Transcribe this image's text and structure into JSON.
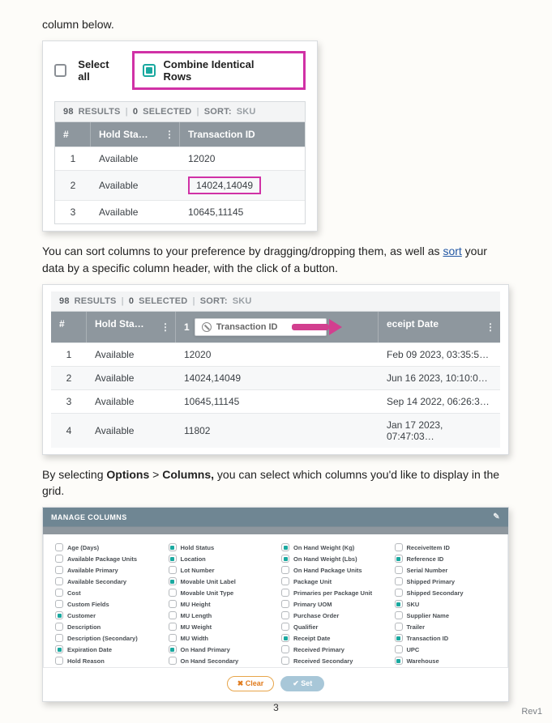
{
  "intro_text": "column below.",
  "select_all_label": "Select all",
  "combine_label": "Combine Identical Rows",
  "results_bar": {
    "count": "98",
    "results_word": "RESULTS",
    "selected_count": "0",
    "selected_word": "SELECTED",
    "sort_label": "SORT:",
    "sort_value": "SKU"
  },
  "headers1": {
    "idx": "#",
    "hold": "Hold Sta…",
    "txn": "Transaction ID"
  },
  "rows1": [
    {
      "n": "1",
      "hold": "Available",
      "txn": "12020"
    },
    {
      "n": "2",
      "hold": "Available",
      "txn": "14024,14049"
    },
    {
      "n": "3",
      "hold": "Available",
      "txn": "10645,11145"
    }
  ],
  "para2a": "You can sort columns to your preference by dragging/dropping them, as well as ",
  "para2_sort": "sort",
  "para2b": " your data by a specific column header, with the click of a button.",
  "headers2": {
    "idx": "#",
    "hold": "Hold Sta…",
    "txn_marker": "1",
    "drag_chip": "Transaction ID",
    "receipt": "eceipt Date"
  },
  "rows2": [
    {
      "n": "1",
      "hold": "Available",
      "txn": "12020",
      "date": "Feb 09 2023, 03:35:5…"
    },
    {
      "n": "2",
      "hold": "Available",
      "txn": "14024,14049",
      "date": "Jun 16 2023, 10:10:0…"
    },
    {
      "n": "3",
      "hold": "Available",
      "txn": "10645,11145",
      "date": "Sep 14 2022, 06:26:3…"
    },
    {
      "n": "4",
      "hold": "Available",
      "txn": "11802",
      "date": "Jan 17 2023, 07:47:03…"
    }
  ],
  "para3a": "By selecting ",
  "para3_opts": "Options",
  "para3_gt": " > ",
  "para3_cols": "Columns,",
  "para3b": " you can select which columns you'd like to display in the grid.",
  "mc_title": "MANAGE COLUMNS",
  "mc_columns": [
    [
      {
        "l": "Age (Days)",
        "c": false
      },
      {
        "l": "Available Package Units",
        "c": false
      },
      {
        "l": "Available Primary",
        "c": false
      },
      {
        "l": "Available Secondary",
        "c": false
      },
      {
        "l": "Cost",
        "c": false
      },
      {
        "l": "Custom Fields",
        "c": false
      },
      {
        "l": "Customer",
        "c": true
      },
      {
        "l": "Description",
        "c": false
      },
      {
        "l": "Description (Secondary)",
        "c": false
      },
      {
        "l": "Expiration Date",
        "c": true
      },
      {
        "l": "Hold Reason",
        "c": false
      }
    ],
    [
      {
        "l": "Hold Status",
        "c": true
      },
      {
        "l": "Location",
        "c": true
      },
      {
        "l": "Lot Number",
        "c": false
      },
      {
        "l": "Movable Unit Label",
        "c": true
      },
      {
        "l": "Movable Unit Type",
        "c": false
      },
      {
        "l": "MU Height",
        "c": false
      },
      {
        "l": "MU Length",
        "c": false
      },
      {
        "l": "MU Weight",
        "c": false
      },
      {
        "l": "MU Width",
        "c": false
      },
      {
        "l": "On Hand Primary",
        "c": true
      },
      {
        "l": "On Hand Secondary",
        "c": false
      }
    ],
    [
      {
        "l": "On Hand Weight (Kg)",
        "c": true
      },
      {
        "l": "On Hand Weight (Lbs)",
        "c": true
      },
      {
        "l": "On Hand Package Units",
        "c": false
      },
      {
        "l": "Package Unit",
        "c": false
      },
      {
        "l": "Primaries per Package Unit",
        "c": false
      },
      {
        "l": "Primary UOM",
        "c": false
      },
      {
        "l": "Purchase Order",
        "c": false
      },
      {
        "l": "Qualifier",
        "c": false
      },
      {
        "l": "Receipt Date",
        "c": true
      },
      {
        "l": "Received Primary",
        "c": false
      },
      {
        "l": "Received Secondary",
        "c": false
      }
    ],
    [
      {
        "l": "ReceiveItem ID",
        "c": false
      },
      {
        "l": "Reference ID",
        "c": true
      },
      {
        "l": "Serial Number",
        "c": false
      },
      {
        "l": "Shipped Primary",
        "c": false
      },
      {
        "l": "Shipped Secondary",
        "c": false
      },
      {
        "l": "SKU",
        "c": true
      },
      {
        "l": "Supplier Name",
        "c": false
      },
      {
        "l": "Trailer",
        "c": false
      },
      {
        "l": "Transaction ID",
        "c": true
      },
      {
        "l": "UPC",
        "c": false
      },
      {
        "l": "Warehouse",
        "c": true
      }
    ]
  ],
  "btn_clear": "Clear",
  "btn_set": "Set",
  "page_number": "3",
  "rev": "Rev1"
}
